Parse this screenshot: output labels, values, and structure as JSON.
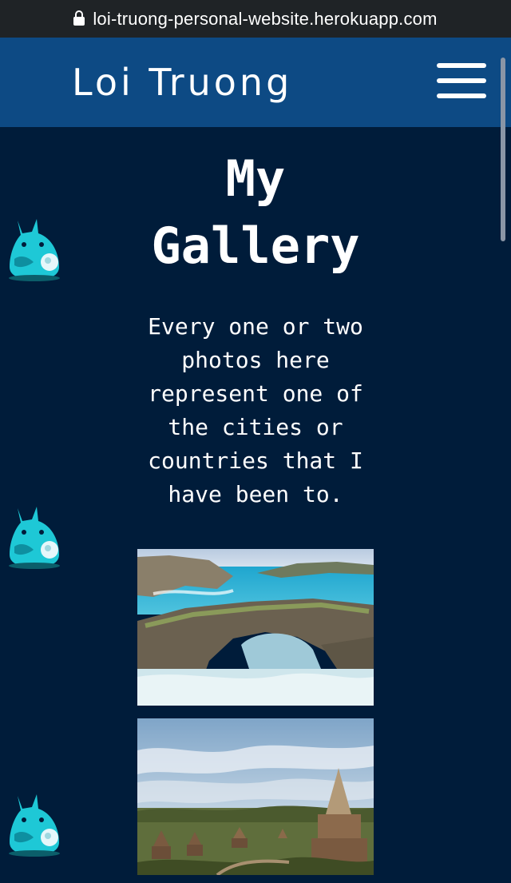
{
  "browser": {
    "url": "loi-truong-personal-website.herokuapp.com"
  },
  "navbar": {
    "brand": "Loi Truong"
  },
  "main": {
    "title_line1": "My",
    "title_line2": "Gallery",
    "intro_lines": [
      "Every one or two",
      "photos here",
      "represent one of",
      "the cities or",
      "countries that I",
      "have been to."
    ]
  },
  "colors": {
    "page_background": "#001c3a",
    "navbar": "#0d4a84",
    "browser_bar": "#1f2326",
    "totoro_accent": "#1ec8d6"
  },
  "icons": {
    "lock": "lock-icon",
    "menu": "hamburger-menu-icon",
    "mascot": "totoro-icon"
  }
}
